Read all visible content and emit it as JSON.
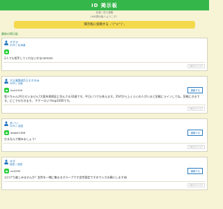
{
  "header": {
    "title": "ID 掲示板",
    "tagline": "友達 / 恋人募集",
    "subtitle": "LINE掲示板へようこそ！"
  },
  "post_button_label": "掲示板に投稿する ／(^o^)＼",
  "section_label": "最新の掲示板",
  "report_label": "通報する",
  "posts": [
    {
      "name": "ずずき",
      "meta": "20代 / 北海道",
      "line_id": "",
      "message": "2人でも相手してくれないかなnemare",
      "date": "08/23 17:27",
      "has_report": false
    },
    {
      "name": "大企業勤務5万ネオのみ",
      "meta": "30代 / 大阪",
      "line_id": "kuzi1000",
      "message": "登人ちゃんが(だせいません?大阪市南那区に住んでる32歳です。平日いつでも休えます。35代から上くらいの人がいると気軽にラインしてね。気軽にきるです。どこでも行きます。 ケケーロいでkop1000です。",
      "date": "08/23 17:27",
      "has_report": true
    },
    {
      "name": "あーい",
      "meta": "20代 / 全国",
      "line_id": "abake1366",
      "message": "ひまなんで絡みましょう！",
      "date": "08/23 17:27",
      "has_report": true
    },
    {
      "name": "ゆず",
      "meta": "秘密 / 全国",
      "line_id": "ne4395",
      "message": "エロアカ楽しみませんか？女性を一緒に集まるグループです女性限定ですのでシカお願いします😂",
      "date": "08/23 17:27",
      "has_report": true
    }
  ]
}
